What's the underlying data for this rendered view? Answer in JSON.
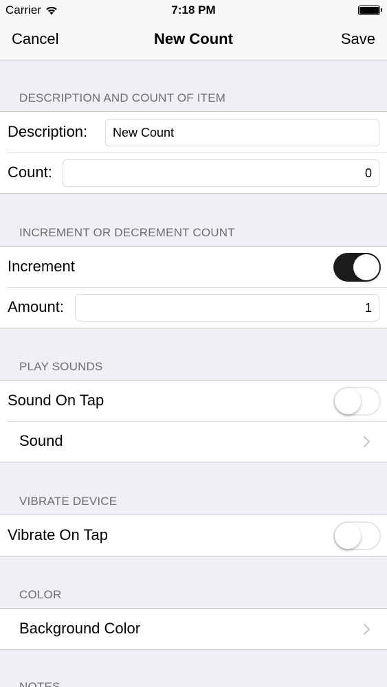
{
  "status_bar": {
    "carrier": "Carrier",
    "time": "7:18 PM"
  },
  "nav": {
    "cancel_label": "Cancel",
    "title": "New Count",
    "save_label": "Save"
  },
  "sections": {
    "description": {
      "header": "DESCRIPTION AND COUNT OF ITEM",
      "description_label": "Description:",
      "description_value": "New Count",
      "count_label": "Count:",
      "count_value": "0"
    },
    "increment": {
      "header": "INCREMENT OR DECREMENT COUNT",
      "increment_label": "Increment",
      "increment_on": true,
      "amount_label": "Amount:",
      "amount_value": "1"
    },
    "sounds": {
      "header": "PLAY SOUNDS",
      "sound_on_tap_label": "Sound On Tap",
      "sound_on_tap_on": false,
      "sound_label": "Sound"
    },
    "vibrate": {
      "header": "VIBRATE DEVICE",
      "vibrate_on_tap_label": "Vibrate On Tap",
      "vibrate_on_tap_on": false
    },
    "color": {
      "header": "COLOR",
      "background_color_label": "Background Color"
    },
    "notes": {
      "header": "NOTES"
    }
  },
  "colors": {
    "toggle_on": "#1c1c1e",
    "section_header": "#6d6d72",
    "background": "#efeff4"
  },
  "icons": {
    "wifi": "wifi-icon",
    "battery": "battery-icon",
    "chevron": "chevron-right-icon"
  }
}
